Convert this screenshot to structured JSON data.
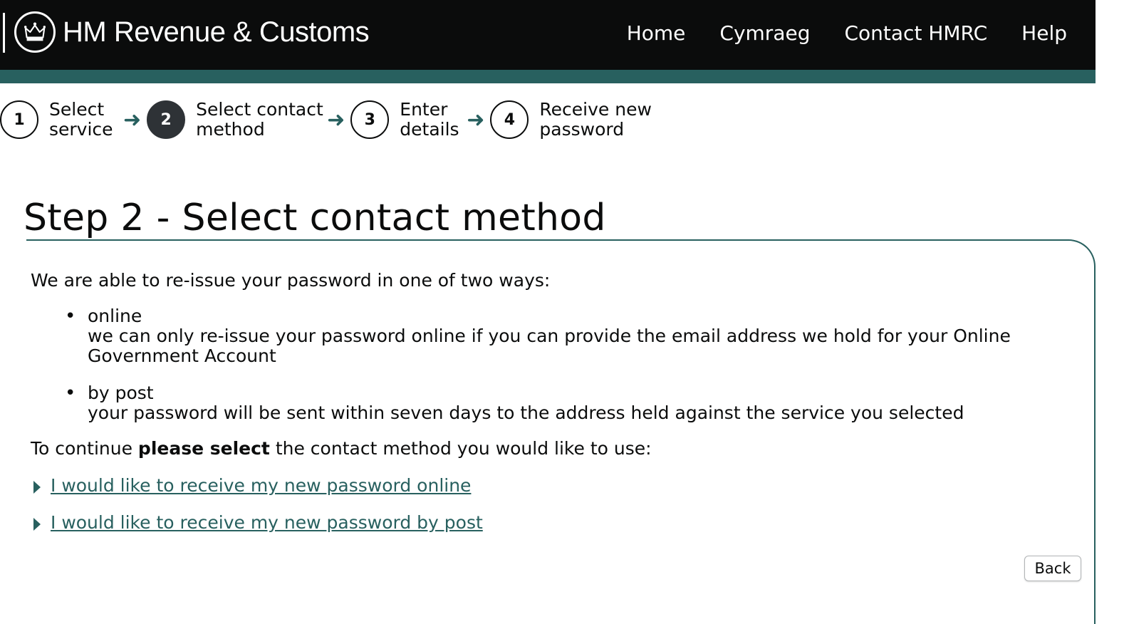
{
  "header": {
    "logo_text": "HM Revenue & Customs",
    "nav": [
      "Home",
      "Cymraeg",
      "Contact HMRC",
      "Help"
    ]
  },
  "steps": [
    {
      "number": "1",
      "line1": "Select",
      "line2": "service",
      "active": false
    },
    {
      "number": "2",
      "line1": "Select contact",
      "line2": "method",
      "active": true
    },
    {
      "number": "3",
      "line1": "Enter",
      "line2": "details",
      "active": false
    },
    {
      "number": "4",
      "line1": "Receive new",
      "line2": "password",
      "active": false
    }
  ],
  "step_arrow": "➜",
  "page_title": "Step 2 - Select contact method",
  "intro": "We are able to re-issue your password in one of two ways:",
  "methods": [
    {
      "title": "online",
      "description": "we can only re-issue your password online if you can provide the email address we hold for your Online Government Account"
    },
    {
      "title": "by post",
      "description": "your password will be sent within seven days to the address held against the service you selected"
    }
  ],
  "instruction": {
    "before": "To continue ",
    "bold": "please select",
    "after": " the contact method you would like to use:"
  },
  "choices": [
    "I would like to receive my new password online",
    "I would like to receive my new password by post"
  ],
  "back_label": "Back",
  "colors": {
    "header_bg": "#0b0c0c",
    "accent": "#28605f"
  },
  "icons": {
    "logo": "royal-crest-icon",
    "arrow": "arrow-right-icon",
    "link": "triangle-right-icon"
  }
}
